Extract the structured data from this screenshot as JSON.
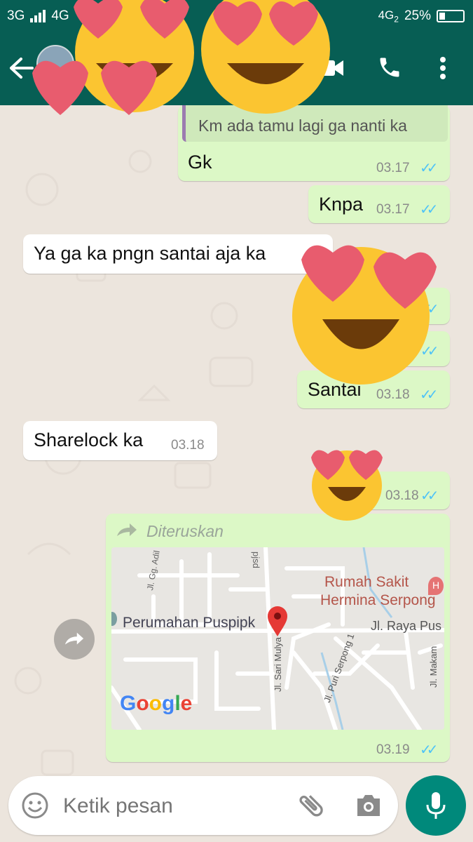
{
  "status_bar": {
    "network_1": "3G",
    "network_2": "4G",
    "network_3": "4G",
    "sim_label": "2",
    "battery": "25%"
  },
  "header": {
    "icons": [
      "back-arrow-icon",
      "avatar",
      "video-call-icon",
      "phone-icon",
      "more-options-icon"
    ]
  },
  "messages": [
    {
      "type": "reply",
      "quoted_text": "Km ada tamu lagi ga nanti ka",
      "text": "Gk",
      "time": "03.17",
      "direction": "out"
    },
    {
      "text": "Knpa",
      "time": "03.17",
      "direction": "out"
    },
    {
      "text": "Ya ga ka pngn santai aja ka",
      "direction": "in"
    },
    {
      "text": "Santai",
      "time": "03.18",
      "direction": "out"
    },
    {
      "text": "Sharelock ka",
      "time": "03.18",
      "direction": "in"
    },
    {
      "text": "",
      "time": "03.18",
      "direction": "out"
    },
    {
      "type": "location",
      "forwarded_label": "Diteruskan",
      "time": "03.19",
      "direction": "out"
    }
  ],
  "map": {
    "labels": {
      "hospital_line1": "Rumah Sakit",
      "hospital_line2": "Hermina Serpong",
      "housing": "Perumahan Puspip",
      "housing_tail": "k",
      "road1": "Jl. Raya Pus",
      "road2": "Jl. Sari Mulya",
      "road3": "Jl. Puri Serpong 1",
      "road4": "Jl. Makam",
      "road5": "Jl. Gg. Adil",
      "road6": "pjsd",
      "logo": "Google"
    }
  },
  "input": {
    "placeholder": "Ketik pesan"
  },
  "colors": {
    "header": "#075e54",
    "outgoing_bubble": "#dcf8c6",
    "incoming_bubble": "#ffffff",
    "ticks": "#4fc3f7",
    "mic": "#00897b"
  }
}
